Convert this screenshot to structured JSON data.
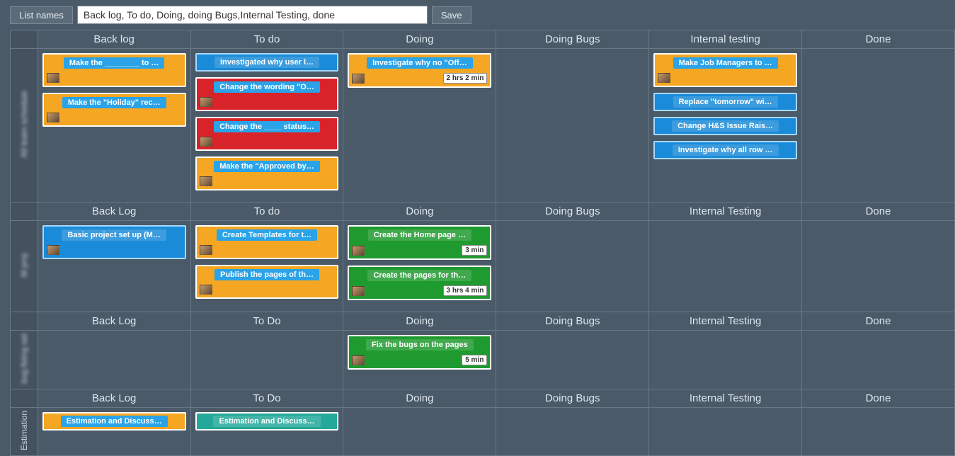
{
  "toolbar": {
    "list_names_btn": "List names",
    "list_names_value": "Back log, To do, Doing, doing Bugs,Internal Testing, done",
    "save_btn": "Save"
  },
  "columns_generic": [
    "Back Log",
    "To Do",
    "Doing",
    "Doing Bugs",
    "Internal Testing",
    "Done"
  ],
  "lanes": [
    {
      "label": "All team schedule",
      "label_clear": false,
      "headers": [
        "Back log",
        "To do",
        "Doing",
        "Doing Bugs",
        "Internal testing",
        "Done"
      ],
      "cells": [
        [
          {
            "color": "orange",
            "title": "Make the ________ to …",
            "avatar": true
          },
          {
            "color": "orange",
            "title": "Make the \"Holiday\" rec…",
            "avatar": true
          }
        ],
        [
          {
            "color": "blue",
            "short": true,
            "title": "Investigated why user l…"
          },
          {
            "color": "red",
            "title": "Change the wording \"O…",
            "avatar": true
          },
          {
            "color": "red",
            "title": "Change the ____ status…",
            "avatar": true
          },
          {
            "color": "orange",
            "title": "Make the \"Approved by…",
            "avatar": true
          }
        ],
        [
          {
            "color": "orange",
            "title": "Investigate why no \"Off…",
            "avatar": true,
            "time": "2 hrs 2 min"
          }
        ],
        [],
        [
          {
            "color": "orange",
            "title": "Make Job Managers to …",
            "avatar": true
          },
          {
            "color": "blue",
            "short": true,
            "title": "Replace \"tomorrow\" wi…"
          },
          {
            "color": "blue",
            "short": true,
            "title": "Change H&S Issue Rais…"
          },
          {
            "color": "blue",
            "short": true,
            "title": "Investigate why all row …"
          }
        ],
        []
      ]
    },
    {
      "label": "M proj",
      "label_clear": false,
      "headers": [
        "Back Log",
        "To do",
        "Doing",
        "Doing Bugs",
        "Internal Testing",
        "Done"
      ],
      "cells": [
        [
          {
            "color": "blue",
            "title": "Basic project set up (M…",
            "avatar": true
          }
        ],
        [
          {
            "color": "orange",
            "title": "Create Templates for t…",
            "avatar": true
          },
          {
            "color": "orange",
            "title": "Publish the pages of th…",
            "avatar": true
          }
        ],
        [
          {
            "color": "green",
            "title": "Create the Home page …",
            "avatar": true,
            "time": "3 min"
          },
          {
            "color": "green",
            "title": "Create the pages for th…",
            "avatar": true,
            "time": "3 hrs 4 min"
          }
        ],
        [],
        [],
        []
      ]
    },
    {
      "label": "bug fixing set",
      "label_clear": false,
      "headers": [
        "Back Log",
        "To Do",
        "Doing",
        "Doing Bugs",
        "Internal Testing",
        "Done"
      ],
      "cells": [
        [],
        [],
        [
          {
            "color": "green",
            "title": "Fix the bugs on the pages",
            "avatar": true,
            "time": "5 min"
          }
        ],
        [],
        [],
        []
      ]
    },
    {
      "label": "Estimation",
      "label_clear": true,
      "headers": [
        "Back Log",
        "To Do",
        "Doing",
        "Doing Bugs",
        "Internal Testing",
        "Done"
      ],
      "cells": [
        [
          {
            "color": "orange",
            "short": true,
            "title": "Estimation and Discuss…"
          }
        ],
        [
          {
            "color": "teal",
            "short": true,
            "title": "Estimation and Discuss…"
          }
        ],
        [],
        [],
        [],
        []
      ]
    }
  ]
}
